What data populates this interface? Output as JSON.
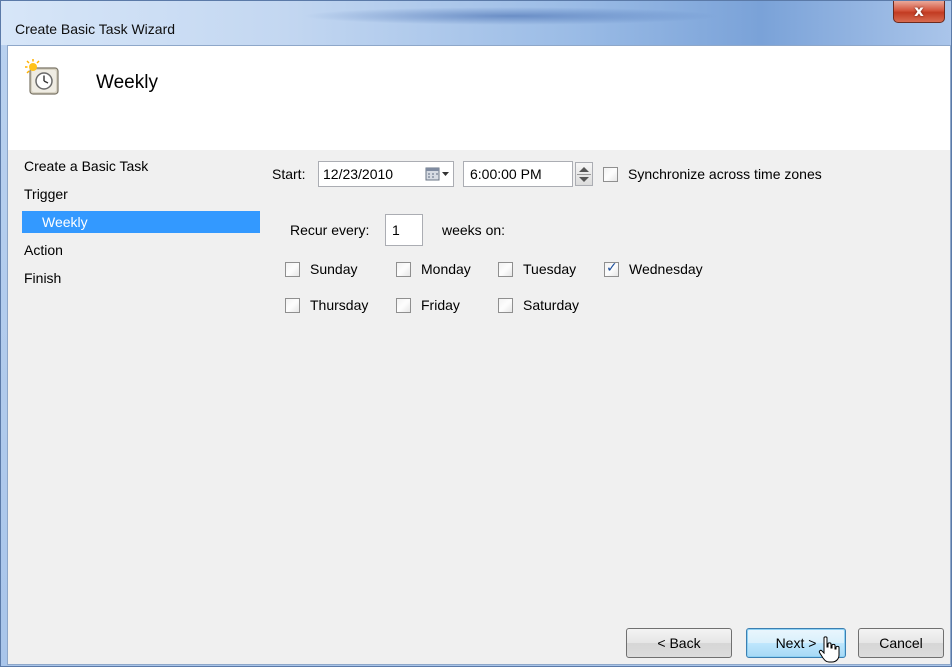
{
  "window": {
    "title": "Create Basic Task Wizard",
    "close_label": "x"
  },
  "header": {
    "title": "Weekly",
    "icon": "scheduled-task-clock-icon"
  },
  "nav": {
    "items": [
      {
        "label": "Create a Basic Task",
        "selected": false
      },
      {
        "label": "Trigger",
        "selected": false
      },
      {
        "label": "Weekly",
        "selected": true
      },
      {
        "label": "Action",
        "selected": false
      },
      {
        "label": "Finish",
        "selected": false
      }
    ]
  },
  "trigger": {
    "start_label": "Start:",
    "start_date": "12/23/2010",
    "start_time": "6:00:00 PM",
    "sync_label": "Synchronize across time zones",
    "sync_checked": false,
    "recur_label": "Recur every:",
    "recur_value": "1",
    "weeks_on_label": "weeks on:",
    "days": [
      {
        "label": "Sunday",
        "checked": false
      },
      {
        "label": "Monday",
        "checked": false
      },
      {
        "label": "Tuesday",
        "checked": false
      },
      {
        "label": "Wednesday",
        "checked": true
      },
      {
        "label": "Thursday",
        "checked": false
      },
      {
        "label": "Friday",
        "checked": false
      },
      {
        "label": "Saturday",
        "checked": false
      }
    ]
  },
  "buttons": {
    "back": "< Back",
    "next": "Next >",
    "cancel": "Cancel"
  },
  "colors": {
    "selection": "#3399ff",
    "panel": "#f0f0f0",
    "close": "#c23b22"
  }
}
